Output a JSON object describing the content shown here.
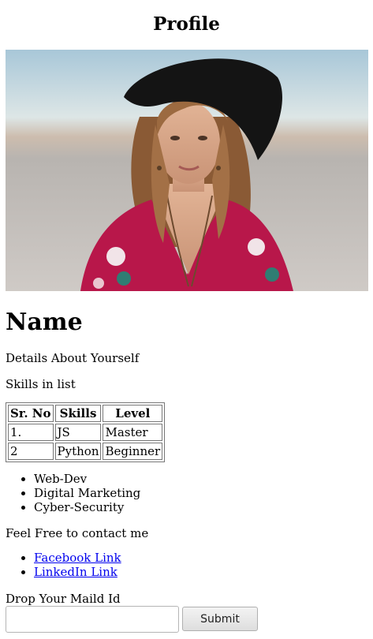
{
  "header": {
    "title": "Profile"
  },
  "profile": {
    "photo_alt": "Profile photo",
    "name": "Name",
    "details": "Details About Yourself",
    "skills_heading": "Skills in list"
  },
  "skills_table": {
    "headers": [
      "Sr. No",
      "Skills",
      "Level"
    ],
    "rows": [
      [
        "1.",
        "JS",
        "Master"
      ],
      [
        "2",
        "Python",
        "Beginner"
      ]
    ]
  },
  "skills_list": [
    "Web-Dev",
    "Digital Marketing",
    "Cyber-Security"
  ],
  "contact": {
    "heading": "Feel Free to contact me",
    "links": [
      "Facebook Link",
      "LinkedIn Link"
    ]
  },
  "form": {
    "label": "Drop Your Maild Id",
    "email_value": "",
    "submit_label": "Submit"
  }
}
